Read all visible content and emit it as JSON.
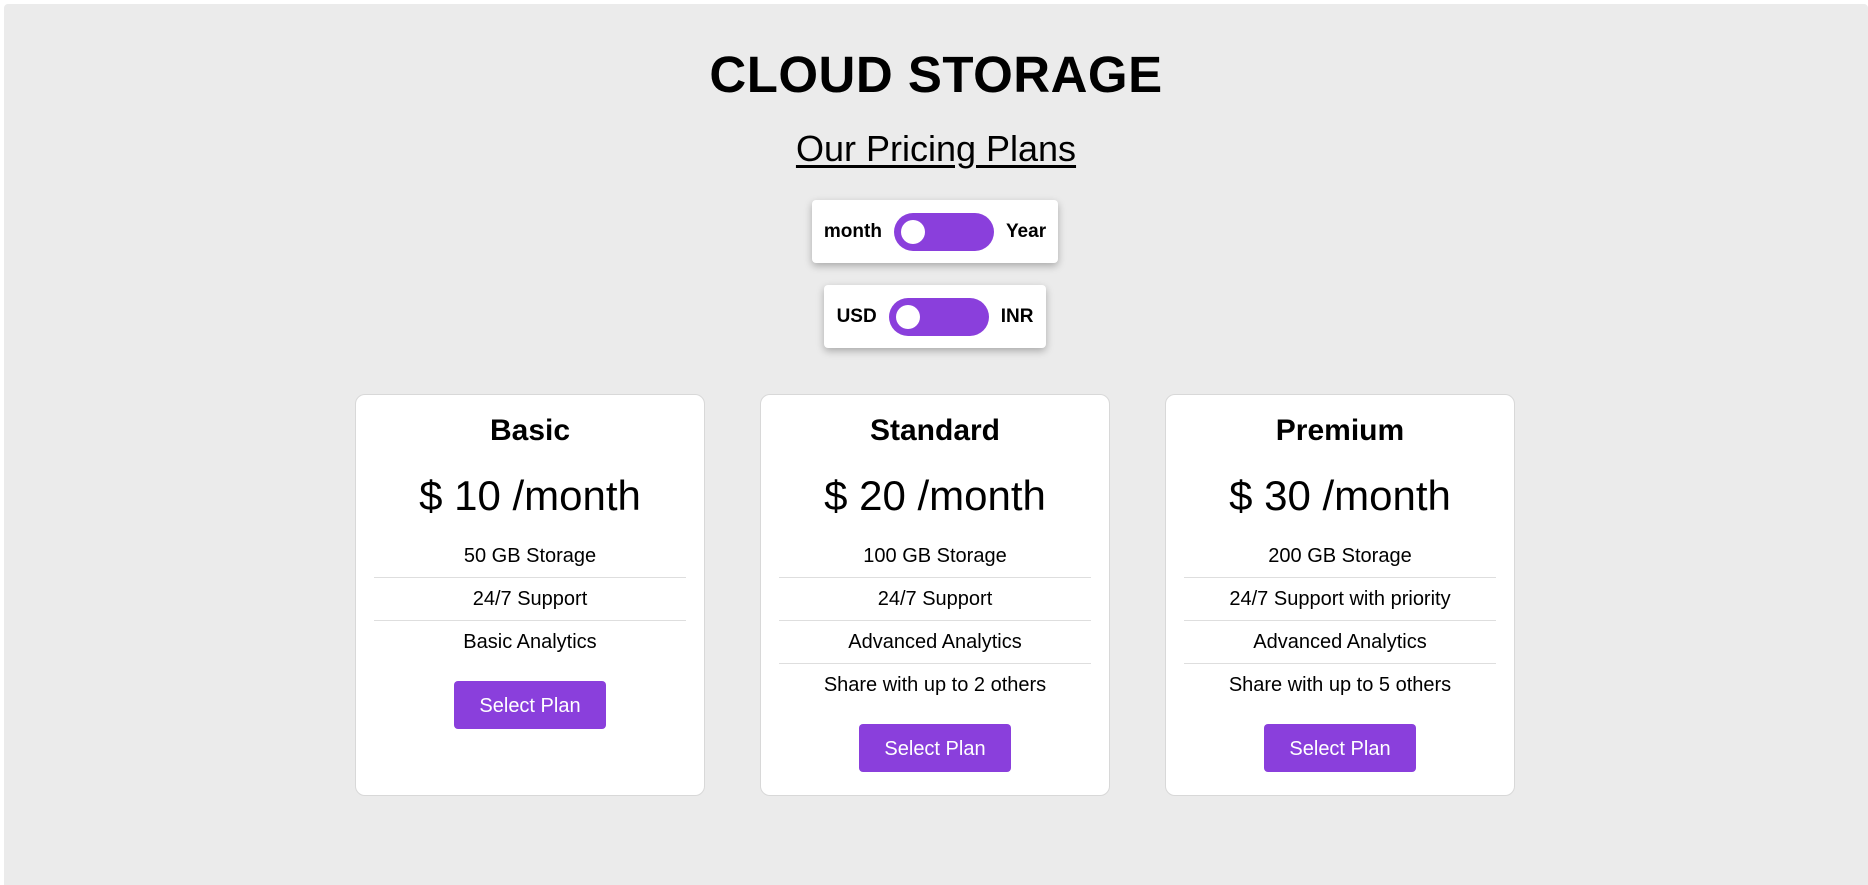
{
  "header": {
    "title": "CLOUD STORAGE",
    "subtitle": "Our Pricing Plans"
  },
  "billing_toggle": {
    "left_label": "month",
    "right_label": "Year",
    "selected": "month"
  },
  "currency_toggle": {
    "left_label": "USD",
    "right_label": "INR",
    "selected": "USD"
  },
  "colors": {
    "accent": "#8a3fdc",
    "background": "#ebebeb",
    "card": "#ffffff"
  },
  "plans": [
    {
      "name": "Basic",
      "price": "$ 10 /month",
      "features": [
        "50 GB Storage",
        "24/7 Support",
        "Basic Analytics"
      ],
      "button_label": "Select Plan"
    },
    {
      "name": "Standard",
      "price": "$ 20 /month",
      "features": [
        "100 GB Storage",
        "24/7 Support",
        "Advanced Analytics",
        "Share with up to 2 others"
      ],
      "button_label": "Select Plan"
    },
    {
      "name": "Premium",
      "price": "$ 30 /month",
      "features": [
        "200 GB Storage",
        "24/7 Support with priority",
        "Advanced Analytics",
        "Share with up to 5 others"
      ],
      "button_label": "Select Plan"
    }
  ]
}
